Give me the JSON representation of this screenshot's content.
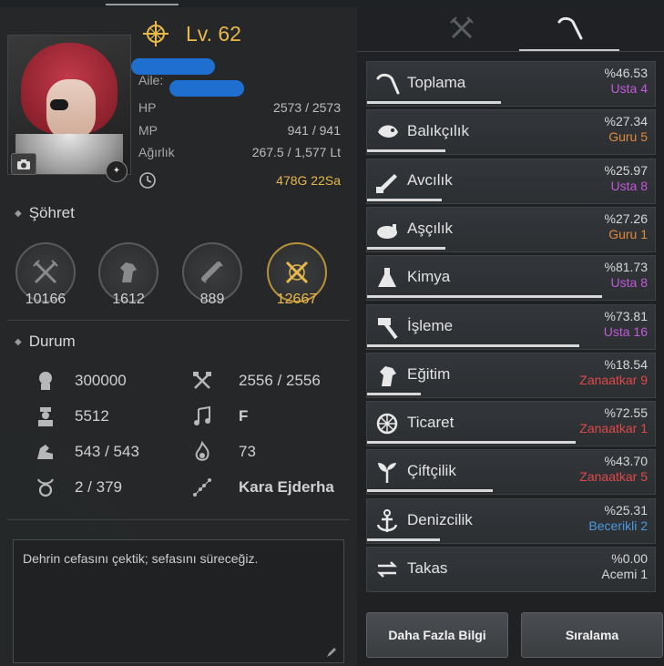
{
  "character": {
    "level_label": "Lv. 62",
    "family_label": "Aile:",
    "hp_label": "HP",
    "hp_value": "2573 / 2573",
    "mp_label": "MP",
    "mp_value": "941 / 941",
    "weight_label": "Ağırlık",
    "weight_value": "267.5 / 1,577 Lt",
    "time_value": "478G 22Sa"
  },
  "fame": {
    "title": "Şöhret",
    "items": [
      {
        "icon": "crossed-swords-icon",
        "value": "10166"
      },
      {
        "icon": "horse-head-icon",
        "value": "1612"
      },
      {
        "icon": "scroll-icon",
        "value": "889"
      },
      {
        "icon": "gold-crossed-swords-icon",
        "value": "12667"
      }
    ]
  },
  "status": {
    "title": "Durum",
    "items": [
      {
        "icon": "contribution-icon",
        "value": "300000"
      },
      {
        "icon": "crossed-axes-icon",
        "value": "2556 / 2556"
      },
      {
        "icon": "character-bust-icon",
        "value": "5512"
      },
      {
        "icon": "music-note-icon",
        "value": "F"
      },
      {
        "icon": "strength-arm-icon",
        "value": "543 / 543"
      },
      {
        "icon": "flame-icon",
        "value": "73"
      },
      {
        "icon": "taurus-icon",
        "value": "2 / 379"
      },
      {
        "icon": "constellation-icon",
        "value": "Kara Ejderha"
      }
    ]
  },
  "motto": "Dehrin cefasını çektik; sefasını süreceğiz.",
  "life_skills": [
    {
      "name": "Toplama",
      "pct": "%46.53",
      "rank": "Usta 4",
      "rank_color": "#c05ad8",
      "progress": 0.4653,
      "icon": "pick-icon"
    },
    {
      "name": "Balıkçılık",
      "pct": "%27.34",
      "rank": "Guru 5",
      "rank_color": "#e08a3c",
      "progress": 0.2734,
      "icon": "fish-icon"
    },
    {
      "name": "Avcılık",
      "pct": "%25.97",
      "rank": "Usta 8",
      "rank_color": "#c05ad8",
      "progress": 0.2597,
      "icon": "musket-icon"
    },
    {
      "name": "Aşçılık",
      "pct": "%27.26",
      "rank": "Guru 1",
      "rank_color": "#e08a3c",
      "progress": 0.2726,
      "icon": "cooking-pot-icon"
    },
    {
      "name": "Kimya",
      "pct": "%81.73",
      "rank": "Usta 8",
      "rank_color": "#c05ad8",
      "progress": 0.8173,
      "icon": "flask-icon"
    },
    {
      "name": "İşleme",
      "pct": "%73.81",
      "rank": "Usta 16",
      "rank_color": "#c05ad8",
      "progress": 0.7381,
      "icon": "hammer-icon"
    },
    {
      "name": "Eğitim",
      "pct": "%18.54",
      "rank": "Zanaatkar 9",
      "rank_color": "#e04848",
      "progress": 0.1854,
      "icon": "horse-icon"
    },
    {
      "name": "Ticaret",
      "pct": "%72.55",
      "rank": "Zanaatkar 1",
      "rank_color": "#e04848",
      "progress": 0.7255,
      "icon": "wheel-icon"
    },
    {
      "name": "Çiftçilik",
      "pct": "%43.70",
      "rank": "Zanaatkar 5",
      "rank_color": "#e04848",
      "progress": 0.437,
      "icon": "sprout-icon"
    },
    {
      "name": "Denizcilik",
      "pct": "%25.31",
      "rank": "Becerikli 2",
      "rank_color": "#4a9ae0",
      "progress": 0.2531,
      "icon": "anchor-icon"
    },
    {
      "name": "Takas",
      "pct": "%0.00",
      "rank": "Acemi 1",
      "rank_color": "#d8d8d8",
      "progress": 0.0,
      "icon": "swap-arrows-icon"
    }
  ],
  "buttons": {
    "more_info": "Daha Fazla Bilgi",
    "ranking": "Sıralama"
  },
  "colors": {
    "gold": "#e8b84a",
    "usta": "#c05ad8",
    "guru": "#e08a3c",
    "zanaatkar": "#e04848",
    "becerikli": "#4a9ae0"
  }
}
